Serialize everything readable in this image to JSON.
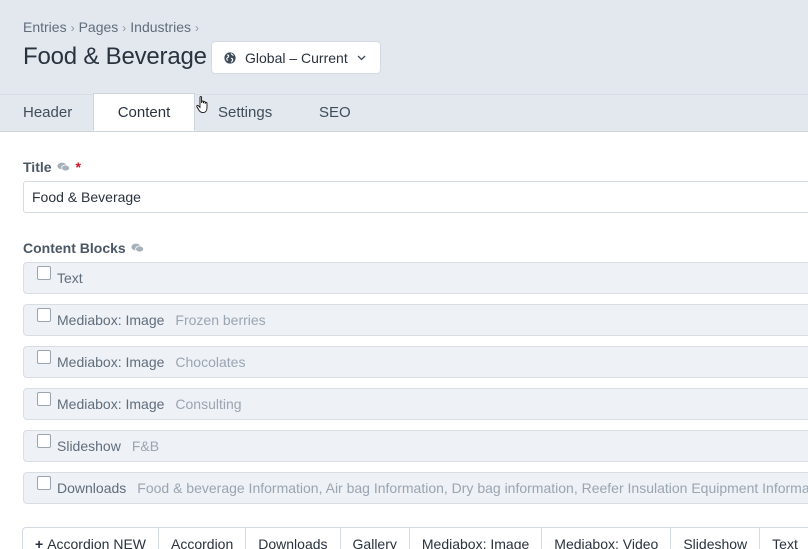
{
  "breadcrumb": [
    "Entries",
    "Pages",
    "Industries"
  ],
  "breadcrumb_sep": "›",
  "page_title": "Food & Beverage",
  "site_menu": {
    "label": "Global – Current",
    "icon": "globe-icon"
  },
  "tabs": [
    {
      "label": "Header"
    },
    {
      "label": "Content",
      "active": true
    },
    {
      "label": "Settings"
    },
    {
      "label": "SEO"
    }
  ],
  "title_field": {
    "label": "Title",
    "required_mark": "*",
    "value": "Food & Beverage"
  },
  "content_blocks": {
    "label": "Content Blocks",
    "items": [
      {
        "type": "Text",
        "summary": ""
      },
      {
        "type": "Mediabox: Image",
        "summary": "Frozen berries"
      },
      {
        "type": "Mediabox: Image",
        "summary": "Chocolates"
      },
      {
        "type": "Mediabox: Image",
        "summary": "Consulting"
      },
      {
        "type": "Slideshow",
        "summary": "F&B"
      },
      {
        "type": "Downloads",
        "summary": "Food & beverage Information, Air bag Information, Dry bag information, Reefer Insulation Equipment Information"
      }
    ]
  },
  "add_buttons": {
    "plus": "+",
    "items": [
      "Accordion NEW",
      "Accordion",
      "Downloads",
      "Gallery",
      "Mediabox: Image",
      "Mediabox: Video",
      "Slideshow",
      "Text"
    ]
  },
  "colors": {
    "header_bg": "#e3e8ef",
    "block_bg": "#eef1f5",
    "required": "#cf1124"
  }
}
